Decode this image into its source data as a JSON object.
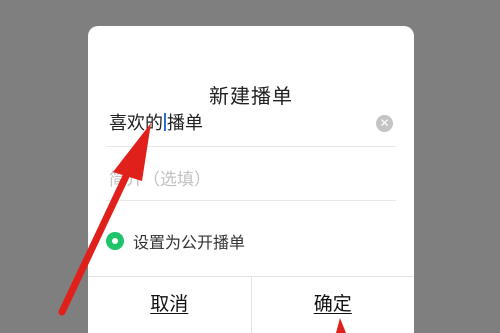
{
  "dialog": {
    "title": "新建播单",
    "name_field": {
      "value_before_caret": "喜欢的",
      "value_after_caret": "播单",
      "clear_icon": "clear-icon"
    },
    "desc_field": {
      "placeholder": "简介（选填）"
    },
    "public_option": {
      "label": "设置为公开播单",
      "checked": true,
      "color": "#21c36b"
    },
    "buttons": {
      "cancel": "取消",
      "confirm": "确定"
    }
  },
  "colors": {
    "overlay": "#7f7f7f",
    "annotation_arrow": "#e0201b",
    "caret": "#2d6fd6"
  },
  "annotation": {
    "icon": "red-arrow-icon"
  }
}
